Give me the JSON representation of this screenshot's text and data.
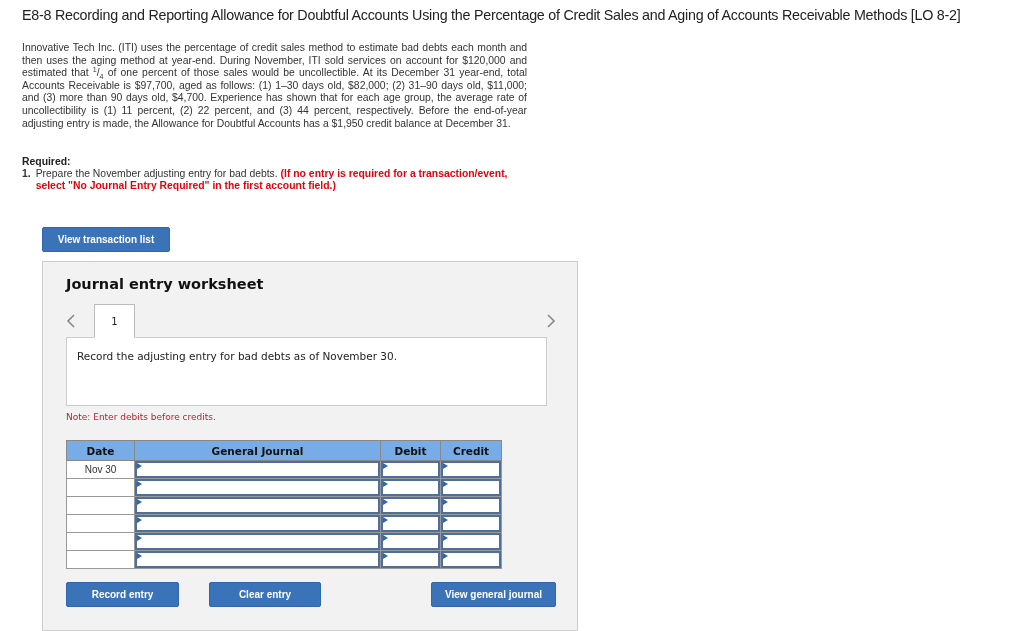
{
  "title": "E8-8 Recording and Reporting Allowance for Doubtful Accounts Using the Percentage of Credit Sales and Aging of Accounts Receivable Methods [LO 8-2]",
  "problem_text": "Innovative Tech Inc. (ITI) uses the percentage of credit sales method to estimate bad debts each month and then uses the aging method at year-end. During November, ITI sold services on account for $120,000 and estimated that $^{1}$/$_{4}$ of one percent of those sales would be uncollectible. At its December 31 year-end, total Accounts Receivable is $97,700, aged as follows: (1) 1–30 days old, $82,000; (2) 31–90 days old, $11,000; and (3) more than 90 days old, $4,700. Experience has shown that for each age group, the average rate of uncollectibility is (1) 11 percent, (2) 22 percent, and (3) 44 percent, respectively. Before the end-of-year adjusting entry is made, the Allowance for Doubtful Accounts has a $1,950 credit balance at December 31.",
  "required": {
    "heading": "Required:",
    "items": [
      {
        "number": "1.",
        "text": "Prepare the November adjusting entry for bad debts.",
        "instruction": "(If no entry is required for a transaction/event, select \"No Journal Entry Required\" in the first account field.)"
      }
    ]
  },
  "view_transaction_button": "View transaction list",
  "worksheet": {
    "title": "Journal entry worksheet",
    "tabs": [
      {
        "label": "1",
        "selected": true
      }
    ],
    "prompt": "Record the adjusting entry for bad debts as of November 30.",
    "note": "Note: Enter debits before credits.",
    "table": {
      "columns": [
        "Date",
        "General Journal",
        "Debit",
        "Credit"
      ],
      "rows": [
        {
          "date": "Nov 30"
        },
        {},
        {},
        {},
        {},
        {}
      ]
    },
    "buttons": [
      "Record entry",
      "Clear entry",
      "View general journal"
    ]
  }
}
